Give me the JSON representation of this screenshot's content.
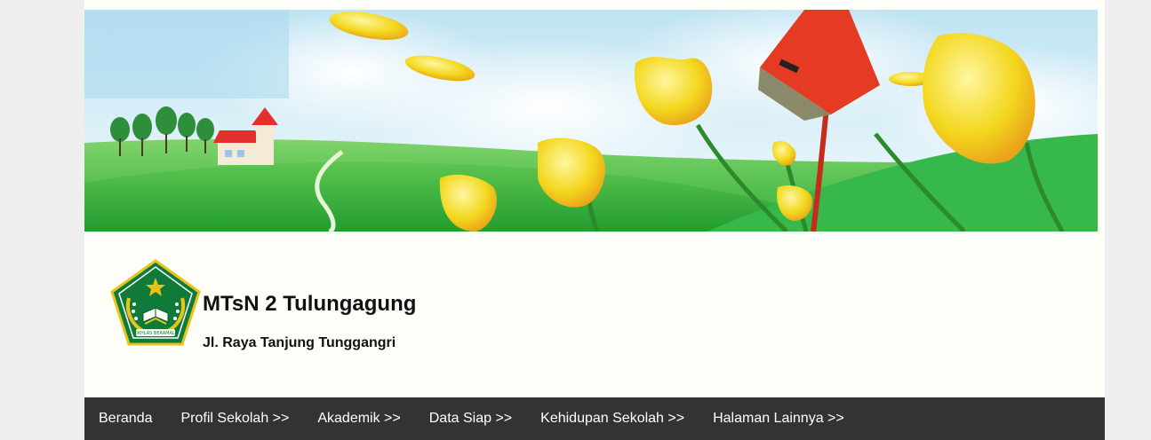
{
  "header": {
    "site_title": "MTsN 2 Tulungagung",
    "site_address": "Jl. Raya Tanjung Tunggangri",
    "logo_ribbon_text": "IKHLAS BERAMAL"
  },
  "nav": {
    "items": [
      {
        "label": "Beranda"
      },
      {
        "label": "Profil Sekolah >>"
      },
      {
        "label": "Akademik >>"
      },
      {
        "label": "Data Siap >>"
      },
      {
        "label": "Kehidupan Sekolah >>"
      },
      {
        "label": "Halaman Lainnya >>"
      }
    ]
  },
  "colors": {
    "page_bg": "#efefef",
    "content_bg": "#fefef8",
    "navbar_bg": "#333333",
    "navbar_text": "#ffffff",
    "logo_green": "#0f7a3a",
    "logo_gold": "#e8c41a"
  }
}
